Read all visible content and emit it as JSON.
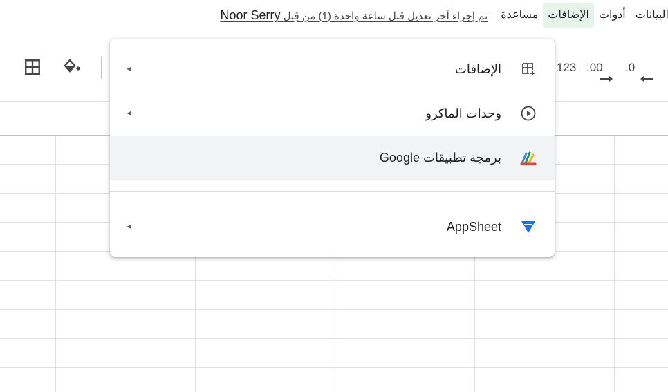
{
  "menubar": {
    "items": [
      "البيانات",
      "أدوات",
      "الإضافات",
      "مساعدة"
    ],
    "last_edit": "تم إجراء آخر تعديل قبل ساعة واحدة (1) من قِبل",
    "last_edit_user": "Noor Serry"
  },
  "toolbar": {
    "decimal_decrease": ".0",
    "decimal_increase": ".00",
    "number_format": "123"
  },
  "extensions_menu": {
    "items": [
      {
        "label": "الإضافات",
        "icon": "addons-icon",
        "submenu": true
      },
      {
        "label": "وحدات الماكرو",
        "icon": "play-circle-icon",
        "submenu": true
      },
      {
        "label": "برمجة تطبيقات Google",
        "icon": "apps-script-icon",
        "submenu": false
      },
      {
        "label": "AppSheet",
        "icon": "appsheet-icon",
        "submenu": true
      }
    ],
    "submenu_arrow": "◄"
  },
  "colors": {
    "active_menu_bg": "#e6f4ea",
    "hover_row_bg": "#f1f3f4",
    "appsheet_blue": "#1a73e8"
  }
}
